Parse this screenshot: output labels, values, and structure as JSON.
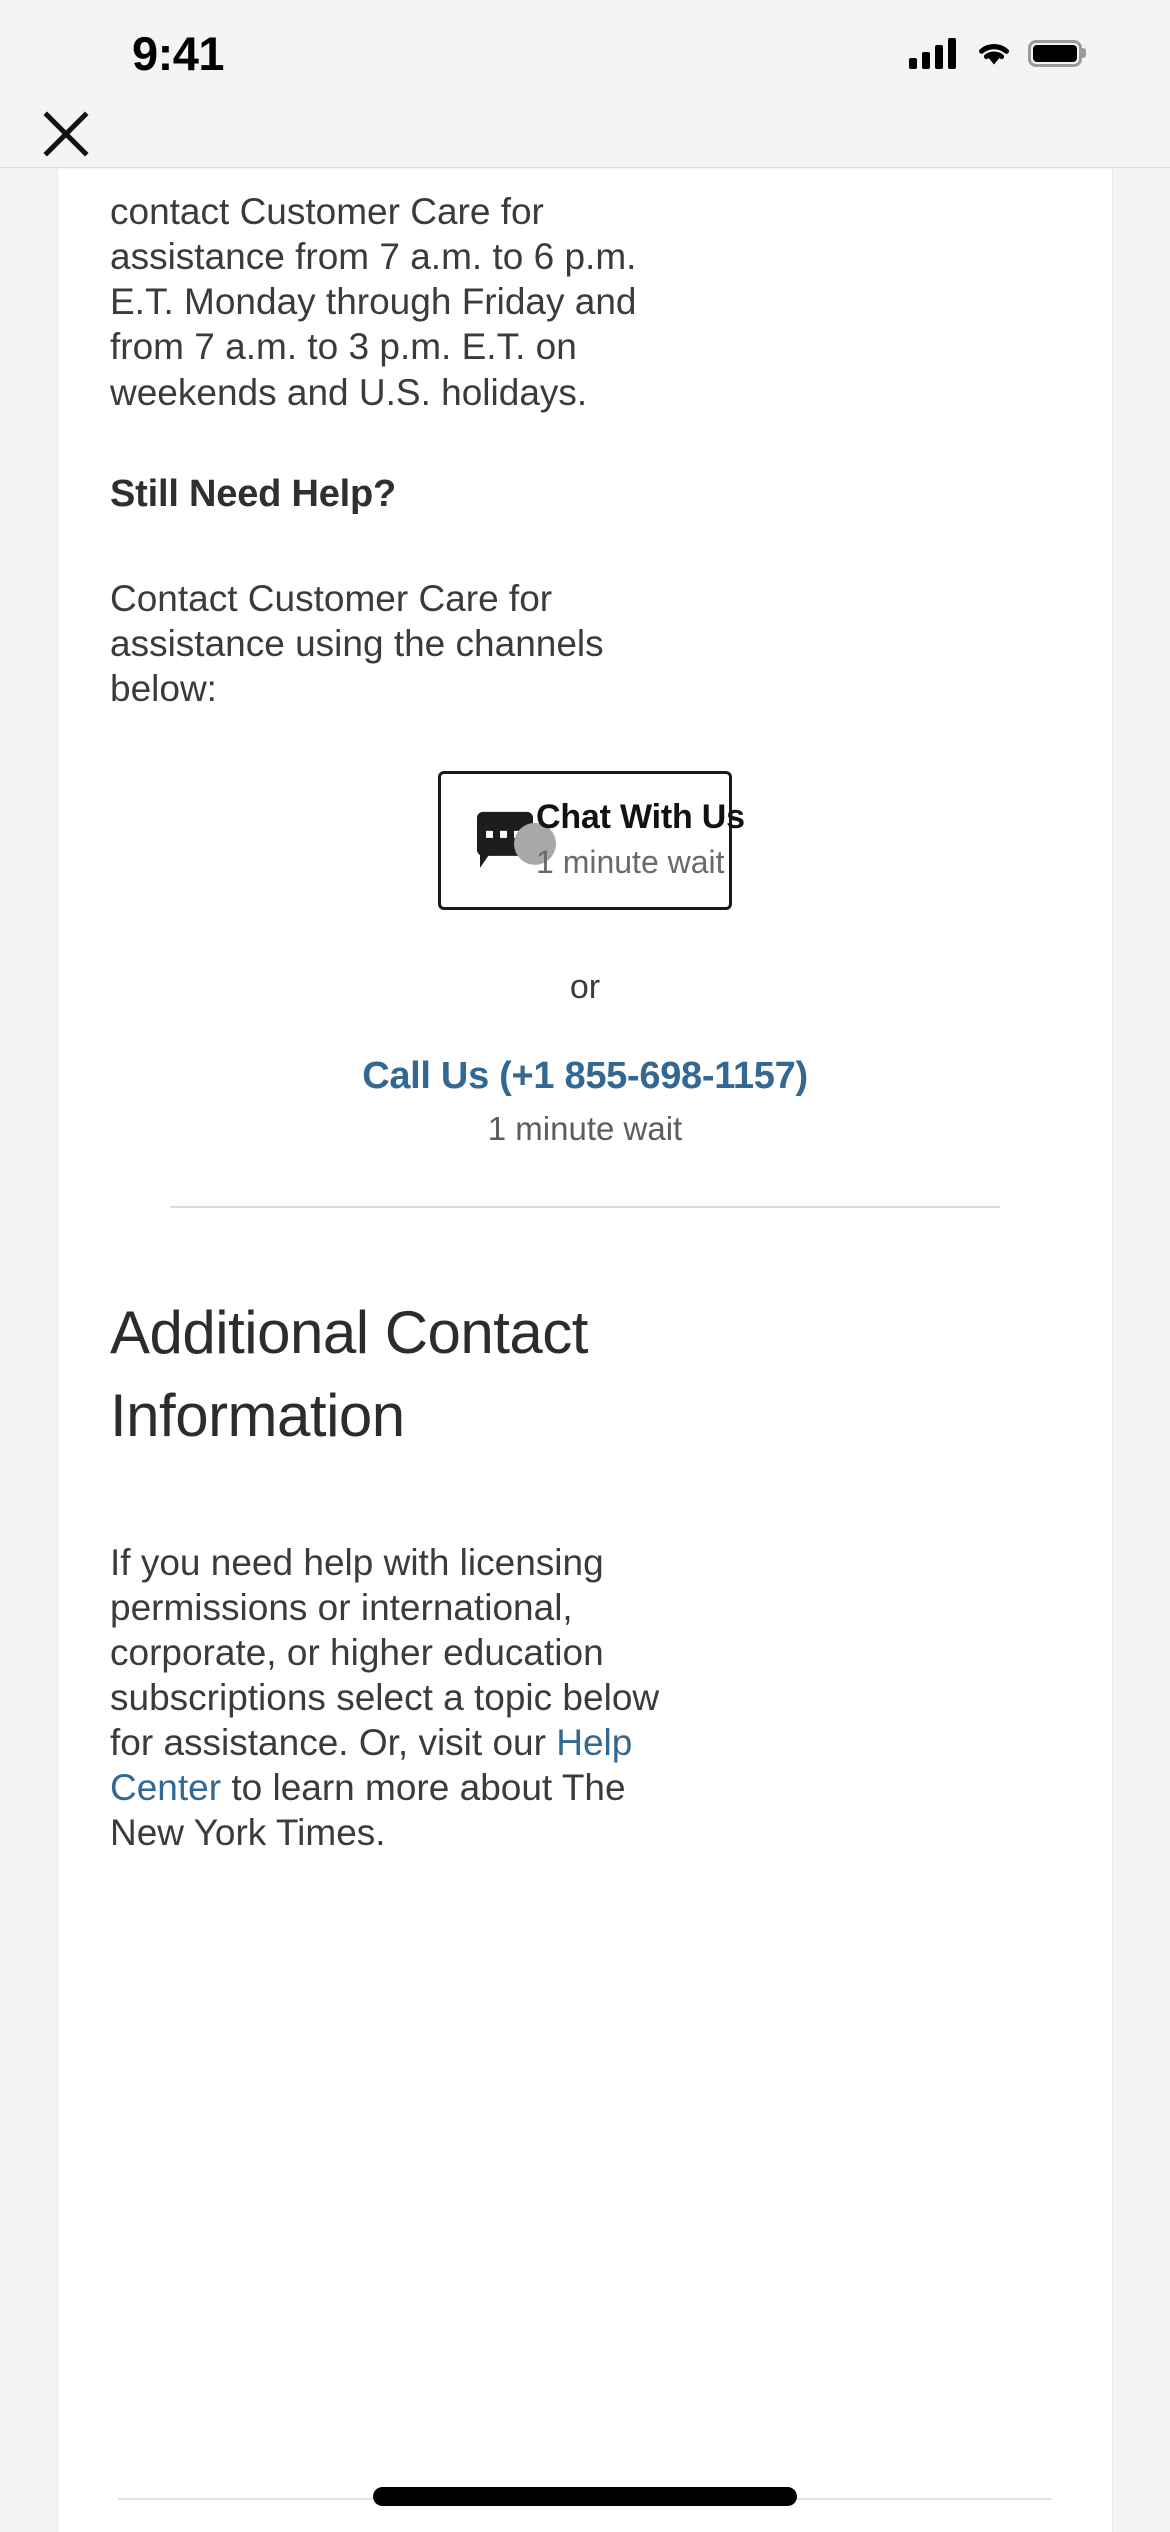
{
  "status_bar": {
    "time": "9:41",
    "cellular_icon": "cellular-signal-icon",
    "wifi_icon": "wifi-icon",
    "battery_icon": "battery-full-icon"
  },
  "nav": {
    "close_icon": "close-icon"
  },
  "content": {
    "hours_paragraph": "contact Customer Care for assistance from 7 a.m. to 6 p.m. E.T. Monday through Friday and from 7 a.m. to 3 p.m. E.T. on weekends and U.S. holidays.",
    "still_need_help_heading": "Still Need Help?",
    "contact_channels_paragraph": "Contact Customer Care for assistance using the channels below:",
    "chat_button": {
      "icon": "chat-bubble-icon",
      "avatar_icon": "agent-avatar-icon",
      "label": "Chat With Us",
      "wait_time": "1 minute wait"
    },
    "or_separator": "or",
    "call": {
      "label": "Call Us (+1 855-698-1157)",
      "wait_time": "1 minute wait"
    },
    "additional_section": {
      "heading": "Additional Contact Information",
      "paragraph_part_1": "If you need help with licensing permissions or international, corporate, or higher education subscriptions select a topic below for assistance. Or, visit our ",
      "link_text": "Help Center",
      "paragraph_part_2": " to learn more about The New York Times."
    }
  },
  "colors": {
    "link_blue": "#326891",
    "text_dark": "#3b3b3b",
    "muted_gray": "#6a6a6a",
    "page_background": "#f4f4f6",
    "card_background": "#ffffff"
  },
  "home_indicator": "home-indicator"
}
